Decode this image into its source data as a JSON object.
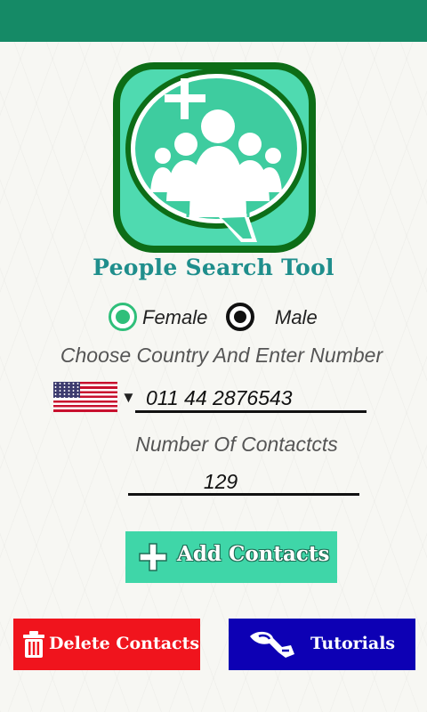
{
  "app": {
    "title": "People Search Tool"
  },
  "gender": {
    "female_label": "Female",
    "male_label": "Male"
  },
  "phone": {
    "prompt": "Choose Country And Enter Number",
    "country": "us-flag-icon",
    "value": "011 44 2876543"
  },
  "contacts": {
    "label": "Number Of Contactcts",
    "value": "129"
  },
  "actions": {
    "add_label": "Add Contacts",
    "delete_label": "Delete Contacts",
    "tutorials_label": "Tutorials"
  },
  "colors": {
    "status_bar": "#158a66",
    "logo_dark": "#0d6d17",
    "logo_fill": "#3fd6a8",
    "title": "#1f8e8c",
    "add_button": "#3fd6a8",
    "delete_button": "#f0141d",
    "tutorials_button": "#0d00b4"
  }
}
